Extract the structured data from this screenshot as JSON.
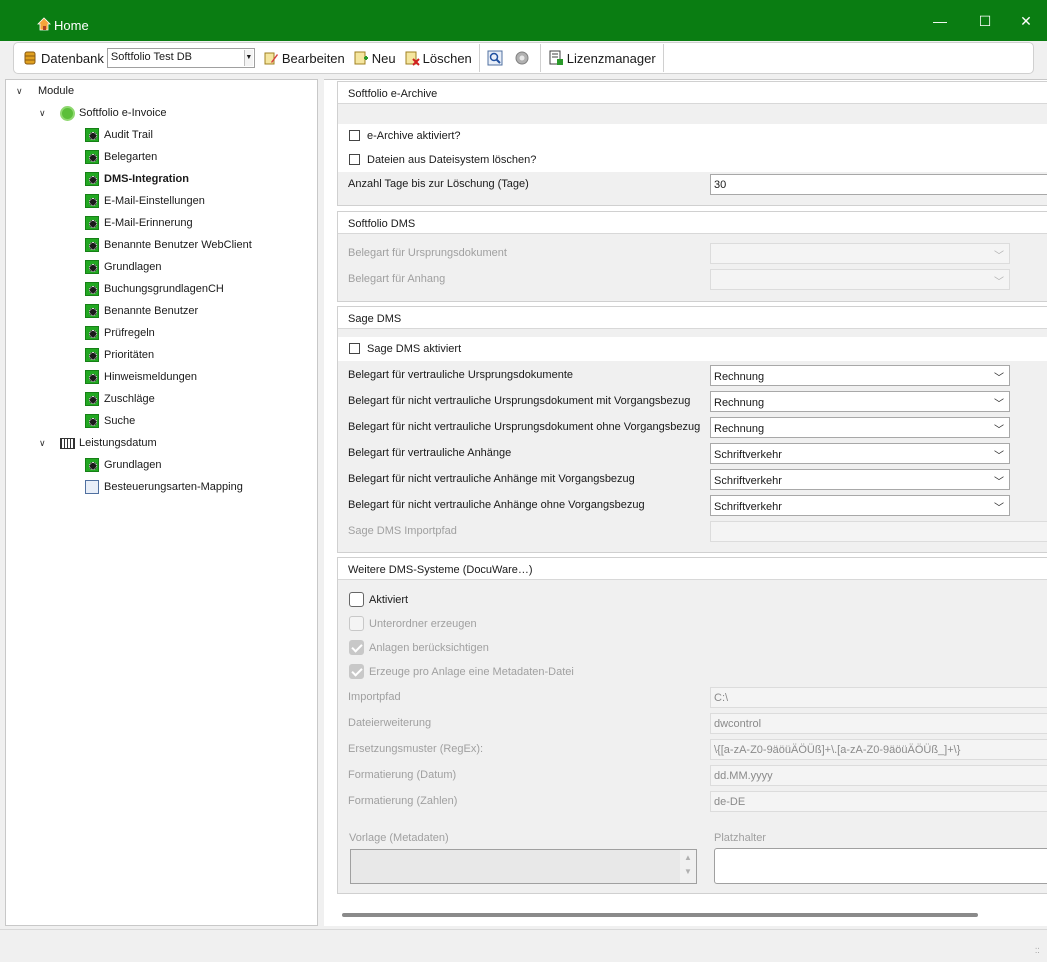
{
  "window": {
    "title": "Home",
    "controls": {
      "minimize": "—",
      "maximize": "☐",
      "close": "✕"
    }
  },
  "toolbar": {
    "database_label": "Datenbank",
    "database_value": "Softfolio Test DB",
    "edit_label": "Bearbeiten",
    "new_label": "Neu",
    "delete_label": "Löschen",
    "license_label": "Lizenzmanager"
  },
  "tree": {
    "root": "Module",
    "einvoice": {
      "label": "Softfolio e-Invoice",
      "items": [
        "Audit Trail",
        "Belegarten",
        "DMS-Integration",
        "E-Mail-Einstellungen",
        "E-Mail-Erinnerung",
        "Benannte Benutzer WebClient",
        "Grundlagen",
        "BuchungsgrundlagenCH",
        "Benannte Benutzer",
        "Prüfregeln",
        "Prioritäten",
        "Hinweismeldungen",
        "Zuschläge",
        "Suche"
      ],
      "selected": "DMS-Integration"
    },
    "leistungsdatum": {
      "label": "Leistungsdatum",
      "items": [
        "Grundlagen",
        "Besteuerungsarten-Mapping"
      ]
    }
  },
  "earchive": {
    "title": "Softfolio e-Archive",
    "activate_label": "e-Archive aktiviert?",
    "delete_files_label": "Dateien aus Dateisystem löschen?",
    "days_label": "Anzahl Tage bis zur Löschung (Tage)",
    "days_value": "30"
  },
  "softfolio_dms": {
    "title": "Softfolio DMS",
    "origin_label": "Belegart für Ursprungsdokument",
    "attachment_label": "Belegart für Anhang"
  },
  "sage_dms": {
    "title": "Sage DMS",
    "activate_label": "Sage DMS aktiviert",
    "rows": [
      {
        "label": "Belegart für vertrauliche Ursprungsdokumente",
        "value": "Rechnung"
      },
      {
        "label": "Belegart für nicht vertrauliche Ursprungsdokument mit Vorgangsbezug",
        "value": "Rechnung"
      },
      {
        "label": "Belegart für nicht vertrauliche Ursprungsdokument ohne Vorgangsbezug",
        "value": "Rechnung"
      },
      {
        "label": "Belegart für vertrauliche Anhänge",
        "value": "Schriftverkehr"
      },
      {
        "label": "Belegart für nicht vertrauliche Anhänge mit Vorgangsbezug",
        "value": "Schriftverkehr"
      },
      {
        "label": "Belegart für nicht vertrauliche Anhänge ohne Vorgangsbezug",
        "value": "Schriftverkehr"
      }
    ],
    "import_path_label": "Sage DMS Importpfad"
  },
  "other_dms": {
    "title": "Weitere DMS-Systeme (DocuWare…)",
    "activated_label": "Aktiviert",
    "subfolder_label": "Unterordner erzeugen",
    "attachments_label": "Anlagen berücksichtigen",
    "metadata_label": "Erzeuge pro Anlage eine Metadaten-Datei",
    "fields": [
      {
        "label": "Importpfad",
        "value": "C:\\"
      },
      {
        "label": "Dateierweiterung",
        "value": "dwcontrol"
      },
      {
        "label": "Ersetzungsmuster (RegEx):",
        "value": "\\{[a-zA-Z0-9äöüÄÖÜß]+\\.[a-zA-Z0-9äöüÄÖÜß_]+\\}"
      },
      {
        "label": "Formatierung (Datum)",
        "value": "dd.MM.yyyy"
      },
      {
        "label": "Formatierung (Zahlen)",
        "value": "de-DE"
      }
    ],
    "template_label": "Vorlage (Metadaten)",
    "placeholder_label": "Platzhalter"
  }
}
